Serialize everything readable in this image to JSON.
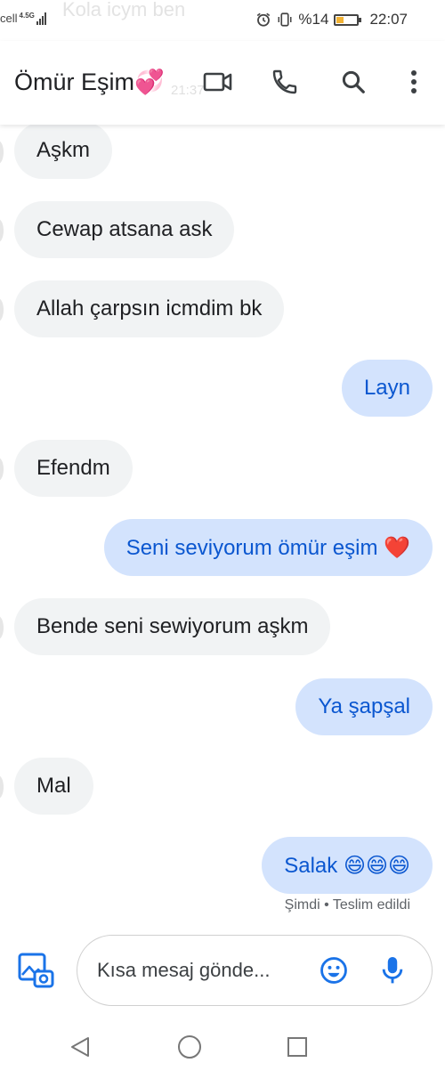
{
  "status_bar": {
    "carrier": "cell",
    "network": "4.5G",
    "ghost_notification": "Kola icym ben",
    "battery_percent": "%14",
    "time": "22:07"
  },
  "header": {
    "contact_name": "Ömür Eşim💞",
    "ghost_time": "21:37",
    "icons": [
      "video-call-icon",
      "phone-icon",
      "search-icon",
      "more-vert-icon"
    ]
  },
  "messages": [
    {
      "direction": "incoming",
      "text": "Aşkm"
    },
    {
      "direction": "incoming",
      "text": "Cewap atsana ask"
    },
    {
      "direction": "incoming",
      "text": "Allah çarpsın icmdim bk"
    },
    {
      "direction": "outgoing",
      "text": "Layn"
    },
    {
      "direction": "incoming",
      "text": "Efendm"
    },
    {
      "direction": "outgoing",
      "text": "Seni seviyorum ömür eşim ❤️"
    },
    {
      "direction": "incoming",
      "text": "Bende seni sewiyorum aşkm"
    },
    {
      "direction": "outgoing",
      "text": "Ya şapşal"
    },
    {
      "direction": "incoming",
      "text": "Mal"
    },
    {
      "direction": "outgoing",
      "text": "Salak 😄😄😄"
    }
  ],
  "delivery_status": "Şimdi • Teslim edildi",
  "compose": {
    "placeholder": "Kısa mesaj gönde..."
  },
  "colors": {
    "incoming_bubble": "#f1f3f4",
    "outgoing_bubble": "#d3e3fd",
    "outgoing_text": "#0b57d0",
    "accent": "#1a73e8"
  }
}
